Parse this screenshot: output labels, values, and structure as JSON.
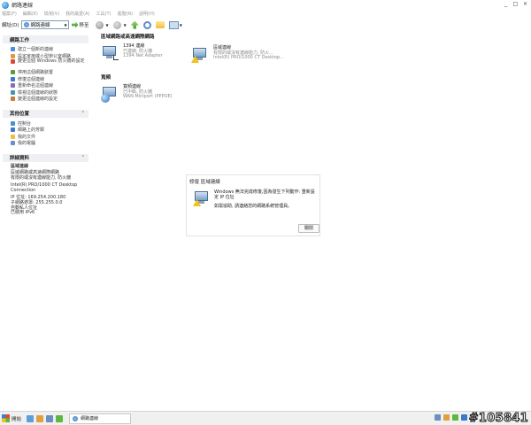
{
  "window": {
    "title": "網路連線",
    "controls": [
      "_",
      "□",
      "×"
    ]
  },
  "menubar": [
    "檔案(F)",
    "編輯(E)",
    "檢視(V)",
    "我的最愛(A)",
    "工具(T)",
    "進階(N)",
    "說明(H)"
  ],
  "toolbar": {
    "address_label": "網址(D)",
    "address_value": "網路連線",
    "go_label": "移至",
    "icons": [
      "back-icon",
      "forward-icon",
      "up-folder-icon",
      "search-icon",
      "folders-icon",
      "views-icon"
    ]
  },
  "sidebar": {
    "network_tasks": {
      "title": "網路工作",
      "items": [
        {
          "label": "建立一個新的連線",
          "color": "#4a8fd8"
        },
        {
          "label": "設定家用或小型辦公室網路",
          "color": "#e09a3a"
        },
        {
          "label": "變更這個 Windows 防火牆的設定",
          "color": "#d24a3a"
        },
        {
          "label": "停用這個網路裝置",
          "color": "#5a9a3a"
        },
        {
          "label": "修復這個連線",
          "color": "#3a7ac8"
        },
        {
          "label": "重新命名這個連線",
          "color": "#8a6ab8"
        },
        {
          "label": "檢視這個連線的狀態",
          "color": "#3a9aa8"
        },
        {
          "label": "變更這個連線的設定",
          "color": "#c87a3a"
        }
      ]
    },
    "other_places": {
      "title": "其他位置",
      "items": [
        {
          "label": "控制台",
          "color": "#4a8fd8"
        },
        {
          "label": "網路上的芳鄰",
          "color": "#3a7ac8"
        },
        {
          "label": "我的文件",
          "color": "#f0be3c"
        },
        {
          "label": "我的電腦",
          "color": "#6a8fc0"
        }
      ]
    },
    "details": {
      "title": "詳細資料",
      "name": "區域連線",
      "lines_a": [
        "區域網路或高速網際網路",
        "有限的或沒有連線能力, 防火牆"
      ],
      "lines_b": [
        "Intel(R) PRO/1000 CT Desktop",
        "Connection"
      ],
      "lines_c": [
        "IP 位址: 169.254.200.180",
        "子網路遮罩: 255.255.0.0",
        "自動私人位址",
        "已啟用 IPv6"
      ]
    }
  },
  "content": {
    "lan_group": {
      "title": "區域網路或高速網際網路",
      "connections": [
        {
          "name": "1394 連線",
          "status": "已連線, 防火牆",
          "device": "1394 Net Adapter"
        },
        {
          "name": "區域連線",
          "status": "有限的或沒有連線能力, 防火...",
          "device": "Intel(R) PRO/1000 CT Desktop..."
        }
      ]
    },
    "broadband_group": {
      "title": "寬頻",
      "connections": [
        {
          "name": "寬頻連線",
          "status": "已中斷, 防火牆",
          "device": "WAN Miniport (PPPOE)"
        }
      ]
    }
  },
  "dialog": {
    "title": "修復 區域連線",
    "message1": "Windows 無法完成修復,因為發生下列動作: 重新設定 IP 位址",
    "message2": "如需協助, 請連絡您的網路系統管理員。",
    "close_label": "關閉"
  },
  "taskbar": {
    "start_label": "開始",
    "task_button_label": "網路連線",
    "watermark": "#105841"
  }
}
